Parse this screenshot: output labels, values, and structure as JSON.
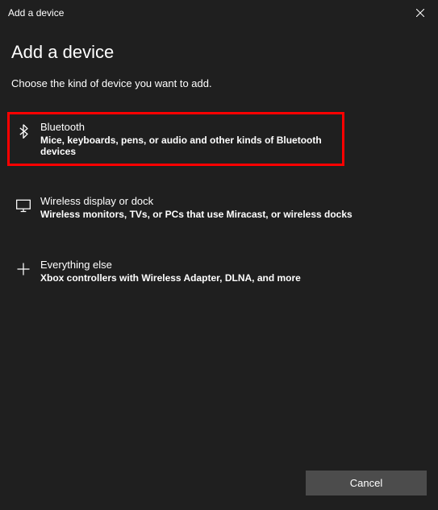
{
  "titlebar": {
    "title": "Add a device"
  },
  "heading": "Add a device",
  "subtitle": "Choose the kind of device you want to add.",
  "options": [
    {
      "title": "Bluetooth",
      "description": "Mice, keyboards, pens, or audio and other kinds of Bluetooth devices"
    },
    {
      "title": "Wireless display or dock",
      "description": "Wireless monitors, TVs, or PCs that use Miracast, or wireless docks"
    },
    {
      "title": "Everything else",
      "description": "Xbox controllers with Wireless Adapter, DLNA, and more"
    }
  ],
  "footer": {
    "cancel_label": "Cancel"
  }
}
